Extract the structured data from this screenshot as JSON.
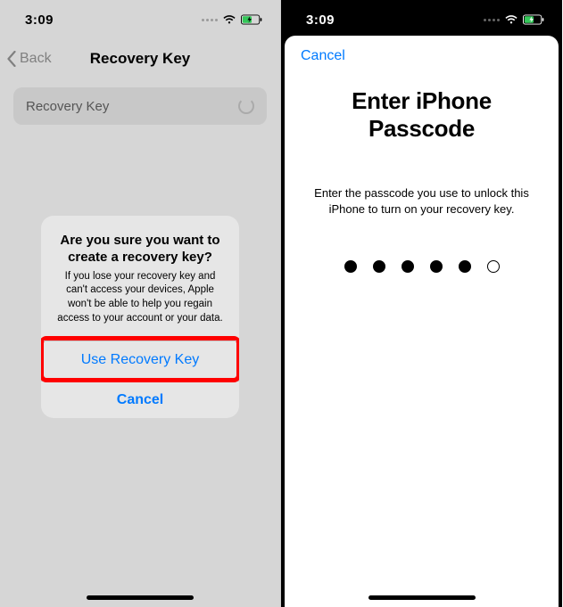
{
  "statusBar": {
    "time": "3:09"
  },
  "left": {
    "back": "Back",
    "title": "Recovery Key",
    "row": {
      "label": "Recovery Key"
    },
    "alert": {
      "title": "Are you sure you want to create a recovery key?",
      "message": "If you lose your recovery key and can't access your devices, Apple won't be able to help you regain access to your account or your data.",
      "confirm": "Use Recovery Key",
      "cancel": "Cancel"
    }
  },
  "right": {
    "cancel": "Cancel",
    "title": "Enter iPhone Passcode",
    "description": "Enter the passcode you use to unlock this iPhone to turn on your recovery key.",
    "passcode": {
      "length": 6,
      "filled": 5
    }
  },
  "colors": {
    "accent": "#007aff",
    "highlight": "#ff0000"
  }
}
